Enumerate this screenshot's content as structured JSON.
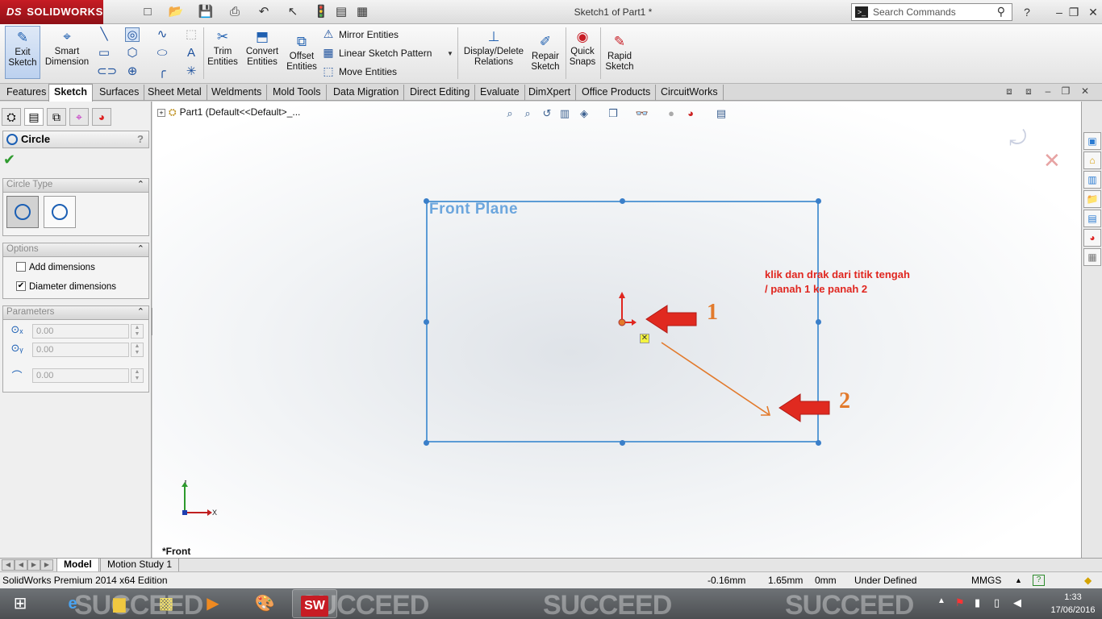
{
  "app": {
    "brand": "SOLIDWORKS",
    "brand_prefix": "DS",
    "doc_title": "Sketch1 of Part1 *",
    "search_placeholder": "Search Commands",
    "help_label": "?"
  },
  "ribbon": {
    "exit_sketch": "Exit\nSketch",
    "smart_dimension": "Smart\nDimension",
    "trim": "Trim\nEntities",
    "convert": "Convert\nEntities",
    "offset": "Offset\nEntities",
    "mirror": "Mirror Entities",
    "linear_pattern": "Linear Sketch Pattern",
    "move": "Move Entities",
    "display_delete": "Display/Delete\nRelations",
    "repair": "Repair\nSketch",
    "quick_snaps": "Quick\nSnaps",
    "rapid_sketch": "Rapid\nSketch"
  },
  "tabs": [
    "Features",
    "Sketch",
    "Surfaces",
    "Sheet Metal",
    "Weldments",
    "Mold Tools",
    "Data Migration",
    "Direct Editing",
    "Evaluate",
    "DimXpert",
    "Office Products",
    "CircuitWorks"
  ],
  "active_tab": "Sketch",
  "property_manager": {
    "title": "Circle",
    "help": "?",
    "circle_type_header": "Circle Type",
    "options_header": "Options",
    "add_dimensions": "Add dimensions",
    "add_dimensions_checked": false,
    "diameter_dimensions": "Diameter dimensions",
    "diameter_dimensions_checked": true,
    "parameters_header": "Parameters",
    "param_cx": "0.00",
    "param_cy": "0.00",
    "param_r": "0.00"
  },
  "graphics": {
    "tree_root": "Part1  (Default<<Default>_...",
    "plane_label": "Front Plane",
    "annotation_line1": "klik dan drak dari titik tengah",
    "annotation_line2": "/ panah 1 ke panah 2",
    "marker1": "1",
    "marker2": "2",
    "view_name": "*Front",
    "axis_x": "X",
    "axis_y": "Y"
  },
  "model_tabs": [
    "Model",
    "Motion Study 1"
  ],
  "status": {
    "edition": "SolidWorks Premium 2014 x64 Edition",
    "x": "-0.16mm",
    "y": "1.65mm",
    "z": "0mm",
    "state": "Under Defined",
    "units": "MMGS"
  },
  "taskbar": {
    "watermark": "SUCCEED",
    "time": "1:33",
    "date": "17/06/2016",
    "solidworks_label": "SW"
  },
  "colors": {
    "brand_red": "#c71c24",
    "plane_blue": "#5b9bd5",
    "annotation_red": "#e0261f",
    "marker_orange": "#e27a2c"
  }
}
